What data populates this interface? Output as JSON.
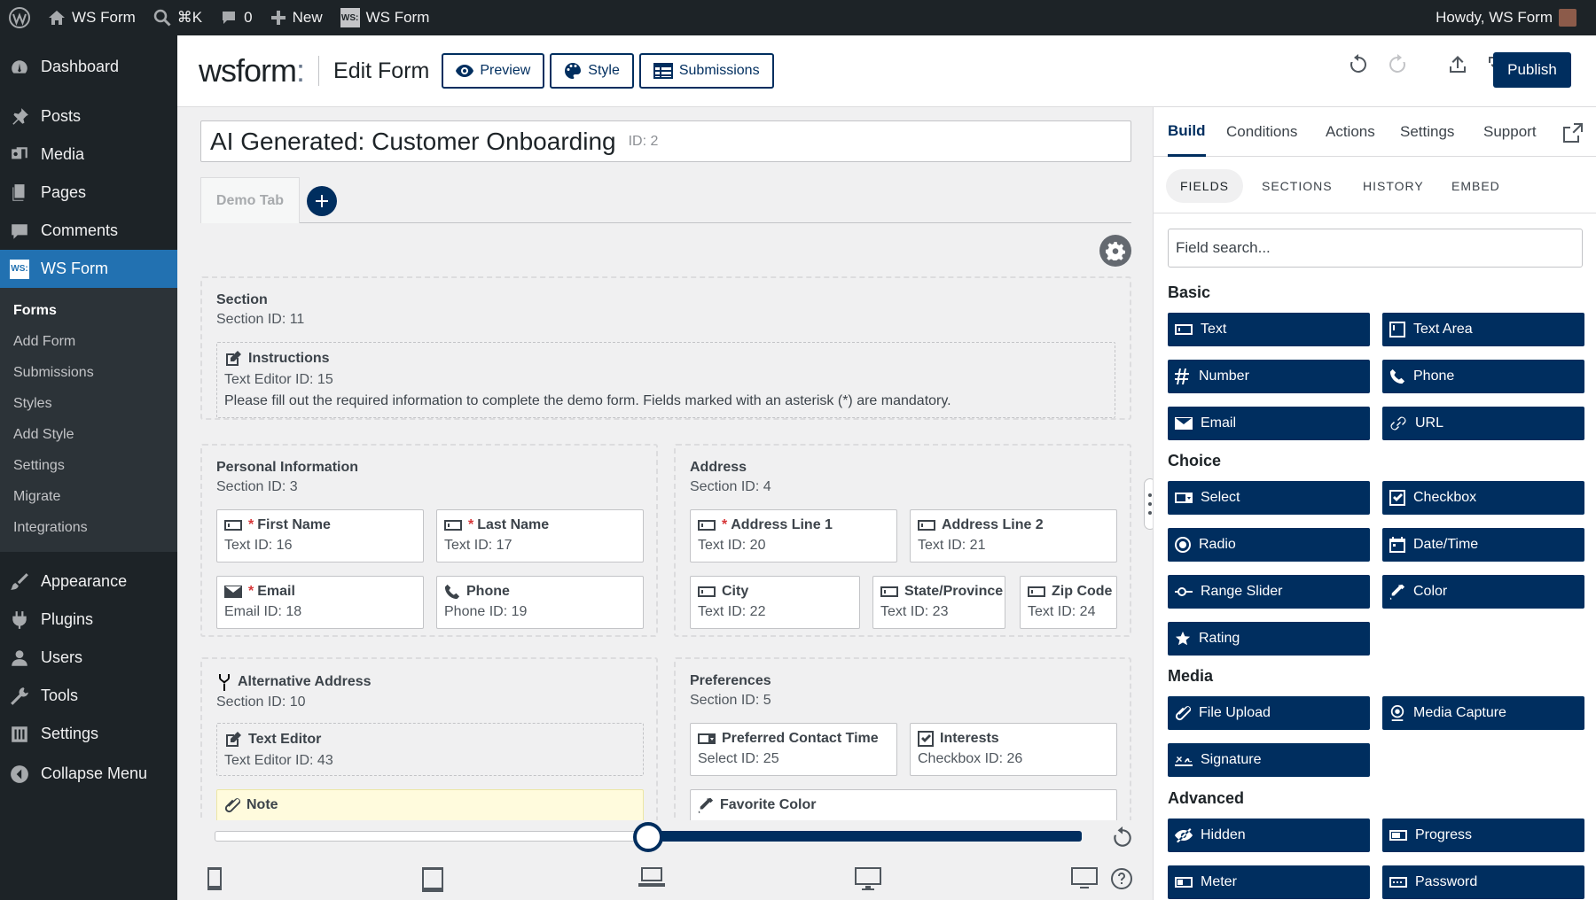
{
  "adminbar": {
    "site_name": "WS Form",
    "search_shortcut": "⌘K",
    "comments_count": "0",
    "new_label": "New",
    "plugin_label": "WS Form",
    "plugin_logo": "WS:",
    "howdy": "Howdy, WS Form"
  },
  "sidebar": {
    "dashboard": "Dashboard",
    "posts": "Posts",
    "media": "Media",
    "pages": "Pages",
    "comments": "Comments",
    "wsform": "WS Form",
    "wsform_logo": "WS:",
    "submenu": [
      "Forms",
      "Add Form",
      "Submissions",
      "Styles",
      "Add Style",
      "Settings",
      "Migrate",
      "Integrations"
    ],
    "appearance": "Appearance",
    "plugins": "Plugins",
    "users": "Users",
    "tools": "Tools",
    "settings": "Settings",
    "collapse": "Collapse Menu"
  },
  "header": {
    "brand_ws": "ws",
    "brand_form": "form",
    "brand_dot": ":",
    "title": "Edit Form",
    "preview": "Preview",
    "style": "Style",
    "submissions": "Submissions",
    "publish": "Publish"
  },
  "form": {
    "name": "AI Generated: Customer Onboarding",
    "id": "ID: 2",
    "tab": "Demo Tab"
  },
  "sections": {
    "section11": {
      "title": "Section",
      "sub": "Section  ID: 11",
      "instructions": {
        "label": "Instructions",
        "sub": "Text Editor  ID: 15",
        "desc": "Please fill out the required information to complete the demo form. Fields marked with an asterisk (*) are mandatory."
      }
    },
    "personal": {
      "title": "Personal Information",
      "sub": "Section  ID: 3",
      "first": {
        "label": "First Name",
        "sub": "Text  ID: 16"
      },
      "last": {
        "label": "Last Name",
        "sub": "Text  ID: 17"
      },
      "email": {
        "label": "Email",
        "sub": "Email  ID: 18"
      },
      "phone": {
        "label": "Phone",
        "sub": "Phone  ID: 19"
      }
    },
    "address": {
      "title": "Address",
      "sub": "Section  ID: 4",
      "line1": {
        "label": "Address Line 1",
        "sub": "Text  ID: 20"
      },
      "line2": {
        "label": "Address Line 2",
        "sub": "Text  ID: 21"
      },
      "city": {
        "label": "City",
        "sub": "Text  ID: 22"
      },
      "state": {
        "label": "State/Province",
        "sub": "Text  ID: 23"
      },
      "zip": {
        "label": "Zip Code",
        "sub": "Text  ID: 24"
      }
    },
    "alternative": {
      "title": "Alternative Address",
      "sub": "Section  ID: 10",
      "texteditor": {
        "label": "Text Editor",
        "sub": "Text Editor  ID: 43"
      },
      "note": {
        "label": "Note"
      }
    },
    "preferences": {
      "title": "Preferences",
      "sub": "Section  ID: 5",
      "contact": {
        "label": "Preferred Contact Time",
        "sub": "Select  ID: 25"
      },
      "interests": {
        "label": "Interests",
        "sub": "Checkbox  ID: 26"
      },
      "color": {
        "label": "Favorite Color"
      }
    }
  },
  "breakpoint_slider": {
    "value_percent": 50
  },
  "panel": {
    "tabs": [
      "Build",
      "Conditions",
      "Actions",
      "Settings",
      "Support"
    ],
    "subtabs": [
      "FIELDS",
      "SECTIONS",
      "HISTORY",
      "EMBED"
    ],
    "search_placeholder": "Field search...",
    "categories": {
      "basic": "Basic",
      "choice": "Choice",
      "media": "Media",
      "advanced": "Advanced"
    },
    "fields": {
      "text": "Text",
      "textarea": "Text Area",
      "number": "Number",
      "phone": "Phone",
      "email": "Email",
      "url": "URL",
      "select": "Select",
      "checkbox": "Checkbox",
      "radio": "Radio",
      "datetime": "Date/Time",
      "range": "Range Slider",
      "color": "Color",
      "rating": "Rating",
      "fileupload": "File Upload",
      "mediacapture": "Media Capture",
      "signature": "Signature",
      "hidden": "Hidden",
      "progress": "Progress",
      "meter": "Meter",
      "password": "Password"
    }
  }
}
